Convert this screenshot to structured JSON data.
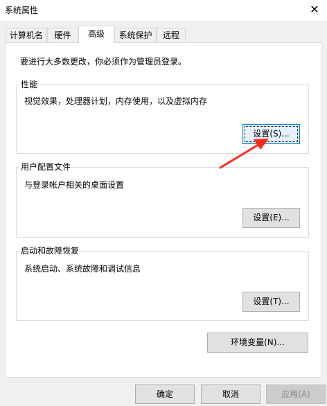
{
  "window": {
    "title": "系统属性",
    "close_glyph": "✕"
  },
  "tabs": [
    "计算机名",
    "硬件",
    "高级",
    "系统保护",
    "远程"
  ],
  "notice": "要进行大多数更改，你必须作为管理员登录。",
  "groups": {
    "performance": {
      "title": "性能",
      "description": "视觉效果，处理器计划，内存使用，以及虚拟内存",
      "button": "设置(S)..."
    },
    "user_profiles": {
      "title": "用户配置文件",
      "description": "与登录帐户相关的桌面设置",
      "button": "设置(E)..."
    },
    "startup_recovery": {
      "title": "启动和故障恢复",
      "description": "系统启动、系统故障和调试信息",
      "button": "设置(T)..."
    }
  },
  "env_button": "环境变量(N)...",
  "footer": {
    "ok": "确定",
    "cancel": "取消",
    "apply": "应用(A)"
  },
  "colors": {
    "annotation_arrow": "#ff2a1a",
    "focus_border": "#0078d7"
  }
}
